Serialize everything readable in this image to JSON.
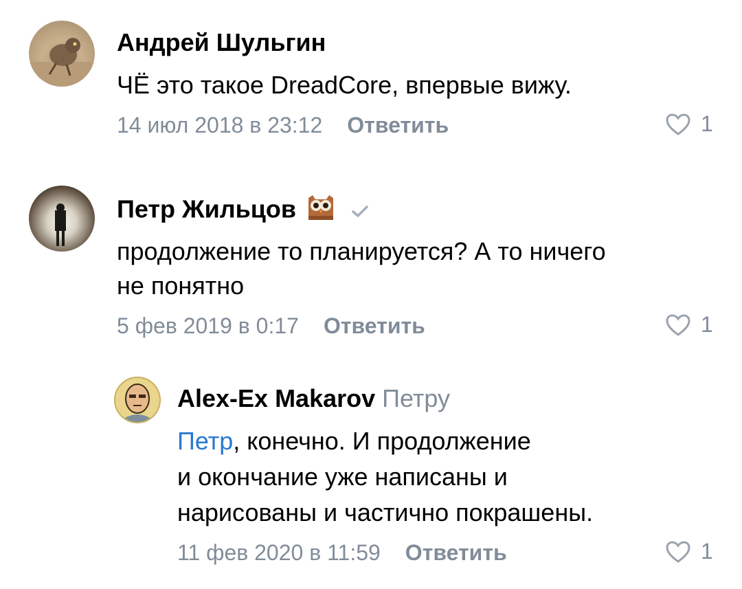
{
  "comments": [
    {
      "author": "Андрей Шульгин",
      "text": "ЧЁ это такое DreadCore, впервые вижу.",
      "date": "14 июл 2018 в 23:12",
      "reply_label": "Ответить",
      "likes": "1",
      "avatar_icon": "owl-photo-avatar"
    },
    {
      "author": "Петр Жильцов",
      "text_line1": "продолжение то планируется? А то ничего",
      "text_line2": "не понятно",
      "date": "5 фев 2019 в 0:17",
      "reply_label": "Ответить",
      "likes": "1",
      "avatar_icon": "person-in-tunnel-avatar",
      "badge_icon": "owl-emoji-icon",
      "verified_icon": "check-icon"
    },
    {
      "author": "Alex-Ex Makarov",
      "reply_to": "Петру",
      "mention": "Петр",
      "text_line1": ", конечно. И продолжение",
      "text_line2": "и окончание уже написаны и",
      "text_line3": "нарисованы и частично покрашены.",
      "date": "11 фев 2020 в 11:59",
      "reply_label": "Ответить",
      "likes": "1",
      "avatar_icon": "comic-face-avatar"
    }
  ],
  "colors": {
    "meta_gray": "#818c99",
    "mention_blue": "#2a78d0"
  }
}
